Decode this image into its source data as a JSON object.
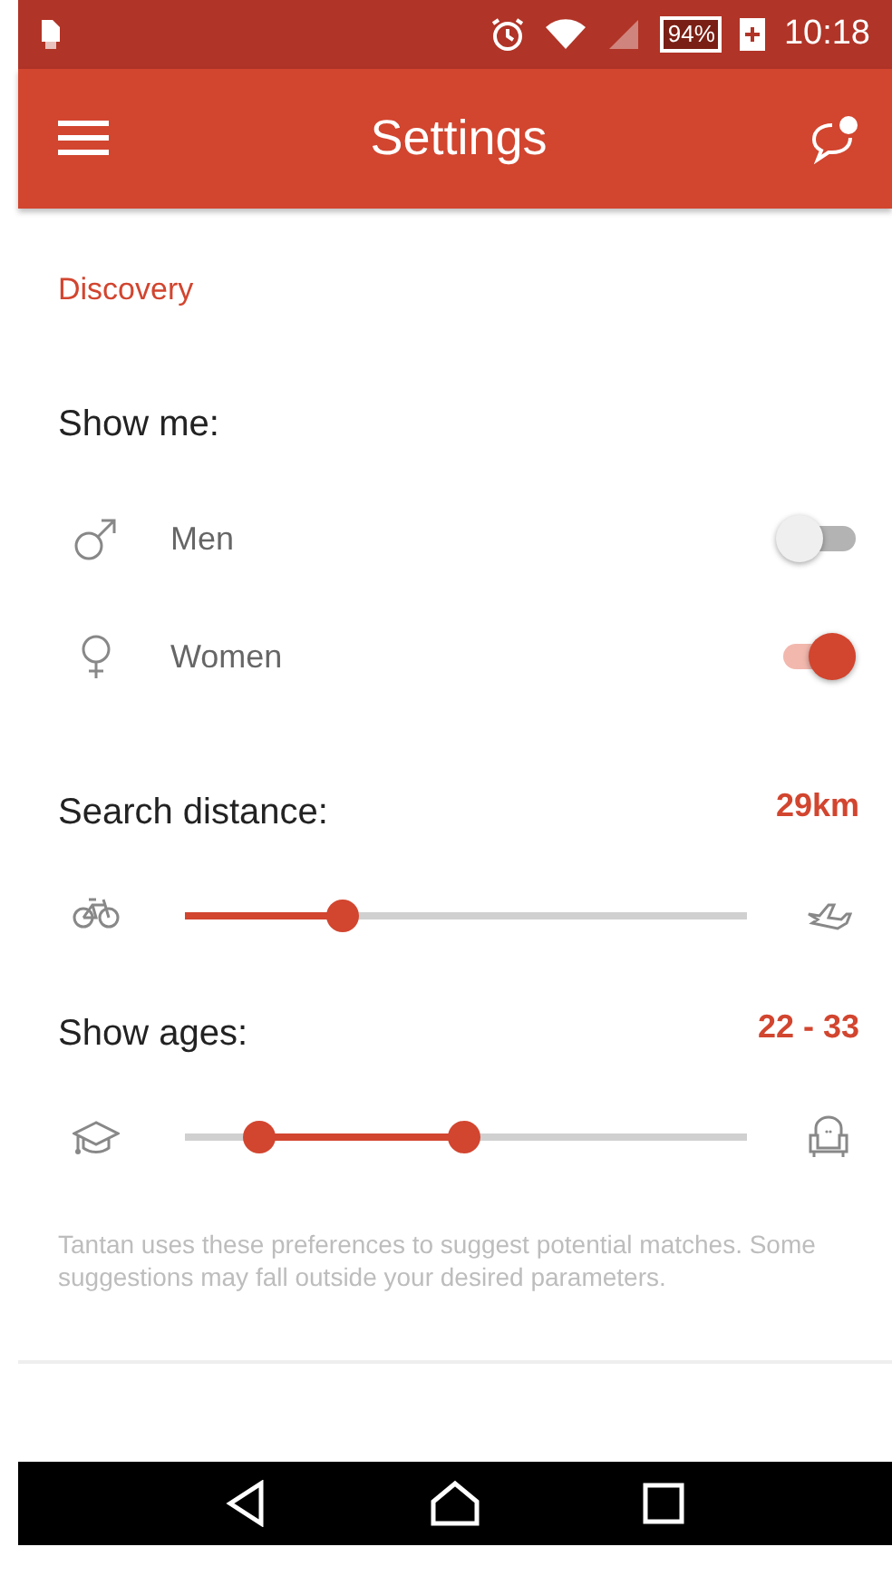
{
  "status_bar": {
    "battery": "94%",
    "time": "10:18"
  },
  "app_bar": {
    "title": "Settings"
  },
  "section": "Discovery",
  "show_me": {
    "label": "Show me:",
    "options": [
      {
        "kind": "male",
        "label": "Men",
        "on": false
      },
      {
        "kind": "female",
        "label": "Women",
        "on": true
      }
    ]
  },
  "sliders": [
    {
      "label": "Search distance:",
      "reading": "29km",
      "kind": "single",
      "level": 0.28
    },
    {
      "label": "Show ages:",
      "reading": "22 - 33",
      "kind": "range",
      "level": [
        0.133,
        0.498
      ]
    }
  ],
  "footnote": "Tantan uses these preferences to suggest potential matches. Some suggestions may fall outside your desired parameters."
}
